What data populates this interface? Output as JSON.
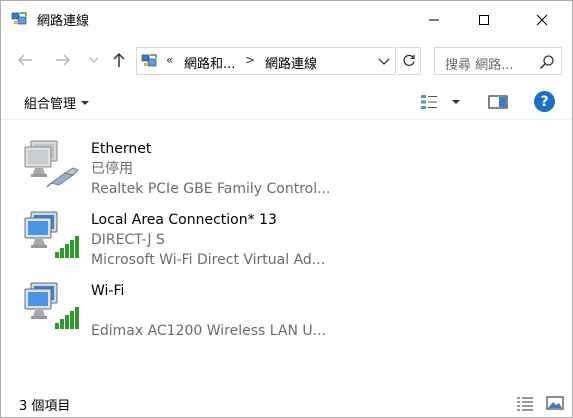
{
  "window": {
    "title": "網路連線"
  },
  "titlebar": {
    "icon": "network-connections-icon",
    "buttons": [
      "minimize",
      "maximize",
      "close"
    ]
  },
  "nav": {
    "back_icon": "arrow-left-icon",
    "forward_icon": "arrow-right-icon",
    "recent_icon": "chevron-down-icon",
    "up_icon": "arrow-up-icon"
  },
  "address": {
    "overflow_marker": "«",
    "crumbs": [
      "網路和...",
      "網路連線"
    ],
    "separator": ">"
  },
  "search": {
    "placeholder": "搜尋 網路..."
  },
  "toolbar": {
    "organize_label": "組合管理"
  },
  "connections": [
    {
      "name": "Ethernet",
      "status": "已停用",
      "device": "Realtek PCIe GBE Family Control...",
      "icon": "ethernet-disabled-icon"
    },
    {
      "name": "Local Area Connection* 13",
      "status": "DIRECT-J          S",
      "device": "Microsoft Wi-Fi Direct Virtual Ad...",
      "icon": "wifi-direct-signal-icon"
    },
    {
      "name": "Wi-Fi",
      "status": "",
      "device": "Edimax AC1200 Wireless LAN U...",
      "icon": "wifi-signal-icon"
    }
  ],
  "statusbar": {
    "count_label": "3 個項目"
  },
  "colors": {
    "help_blue": "#1a6fc6",
    "signal_green": "#2e9a2e",
    "secondary_text": "#6d6d6d"
  }
}
